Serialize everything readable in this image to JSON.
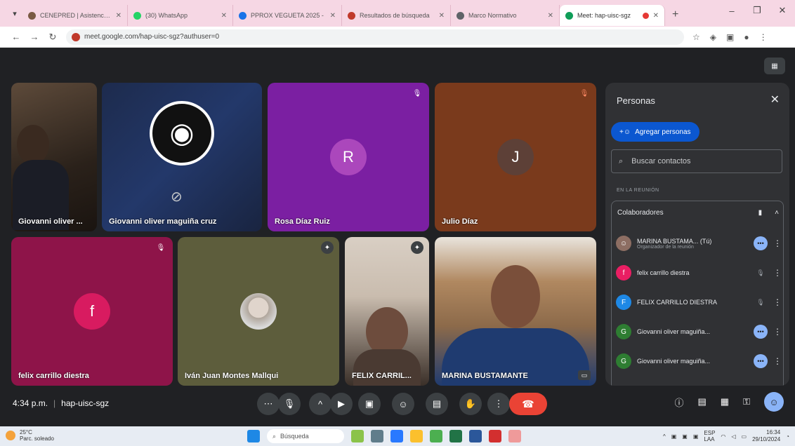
{
  "browser": {
    "tabs": [
      {
        "title": "CENEPRED | Asistencia té",
        "color": "#7a5a44"
      },
      {
        "title": "(30) WhatsApp",
        "color": "#25d366"
      },
      {
        "title": "PPROX VEGUETA 2025 -",
        "color": "#1a73e8"
      },
      {
        "title": "Resultados de búsqueda",
        "color": "#c0392b"
      },
      {
        "title": "Marco Normativo",
        "color": "#5f6368"
      },
      {
        "title": "Meet: hap-uisc-sgz",
        "color": "#0f9d58"
      }
    ],
    "url": "meet.google.com/hap-uisc-sgz?authuser=0"
  },
  "tiles": [
    {
      "name": "Giovanni oliver ...",
      "kind": "video"
    },
    {
      "name": "Giovanni oliver maguiña cruz",
      "kind": "obs"
    },
    {
      "name": "Rosa Díaz Ruiz",
      "initial": "R",
      "bg": "#7b1fa2",
      "avatar": "#ab47bc"
    },
    {
      "name": "Julio Díaz",
      "initial": "J",
      "bg": "#7a3a1c",
      "avatar": "#5d4037"
    },
    {
      "name": "felix carrillo diestra",
      "initial": "f",
      "bg": "#8e1449",
      "avatar": "#d81b60"
    },
    {
      "name": "Iván Juan Montes Mallqui",
      "kind": "photo",
      "bg": "#5d5d3c"
    },
    {
      "name": "FELIX CARRIL...",
      "kind": "video2"
    },
    {
      "name": "MARINA BUSTAMANTE",
      "kind": "video3"
    }
  ],
  "controls": {
    "time": "4:34 p.m.",
    "meeting_code": "hap-uisc-sgz"
  },
  "panel": {
    "title": "Personas",
    "add_label": "Agregar personas",
    "search_placeholder": "Buscar contactos",
    "section": "EN LA REUNIÓN",
    "group": "Colaboradores",
    "people": [
      {
        "name": "MARINA BUSTAMA...",
        "you": "(Tú)",
        "role": "Organizador de la reunión",
        "initial": "",
        "color": "#8d6e63"
      },
      {
        "name": "felix carrillo diestra",
        "initial": "f",
        "color": "#e91e63"
      },
      {
        "name": "FELIX CARRILLO DIESTRA",
        "initial": "F",
        "color": "#1e88e5"
      },
      {
        "name": "Giovanni oliver maguiña...",
        "initial": "G",
        "color": "#2e7d32"
      },
      {
        "name": "Giovanni oliver maguiña...",
        "initial": "G",
        "color": "#2e7d32"
      }
    ]
  },
  "taskbar": {
    "temp": "25°C",
    "weather": "Parc. soleado",
    "search": "Búsqueda",
    "lang1": "ESP",
    "lang2": "LAA",
    "time": "16:34",
    "date": "29/10/2024"
  }
}
